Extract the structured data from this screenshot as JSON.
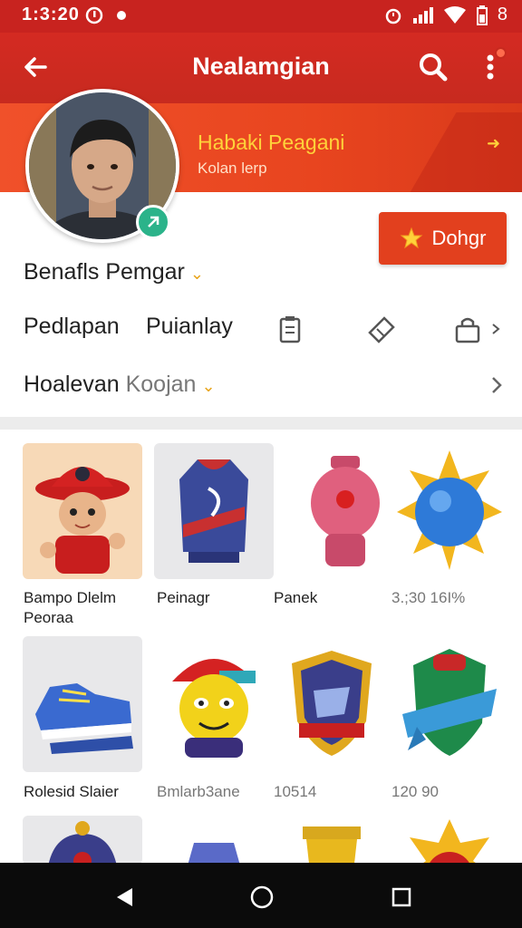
{
  "status_bar": {
    "time": "1:3:20",
    "battery_text": "8"
  },
  "app_bar": {
    "title": "Nealamgian"
  },
  "profile": {
    "name": "Habaki Peagani",
    "subtitle": "Kolan lerp",
    "follow_label": "Dohgr",
    "detail_line": "Benafls Pemgar",
    "tab_left": "Pedlapan",
    "tab_right": "Puianlay",
    "section_dark": "Hoalevan",
    "section_light": "Koojan"
  },
  "items": [
    {
      "label": "Bampo Dlelm",
      "label2": "Peoraa",
      "icon": "fireman-character-icon"
    },
    {
      "label": "Peinagr",
      "icon": "jersey-vest-icon"
    },
    {
      "label": "Panek",
      "icon": "vase-icon"
    },
    {
      "label": "3.;30 16I%",
      "icon": "sun-orb-icon"
    },
    {
      "label": "Rolesid Slaier",
      "icon": "sneakers-icon"
    },
    {
      "label": "Bmlarb3ane",
      "icon": "cap-character-icon"
    },
    {
      "label": "10514",
      "icon": "shield-emblem-icon"
    },
    {
      "label": "120 90",
      "icon": "banner-shield-icon"
    }
  ],
  "colors": {
    "app_bar": "#c8231f",
    "banner": "#f0512a",
    "accent_yellow": "#ffd23a",
    "button": "#e2401e",
    "badge": "#2bb38a"
  }
}
